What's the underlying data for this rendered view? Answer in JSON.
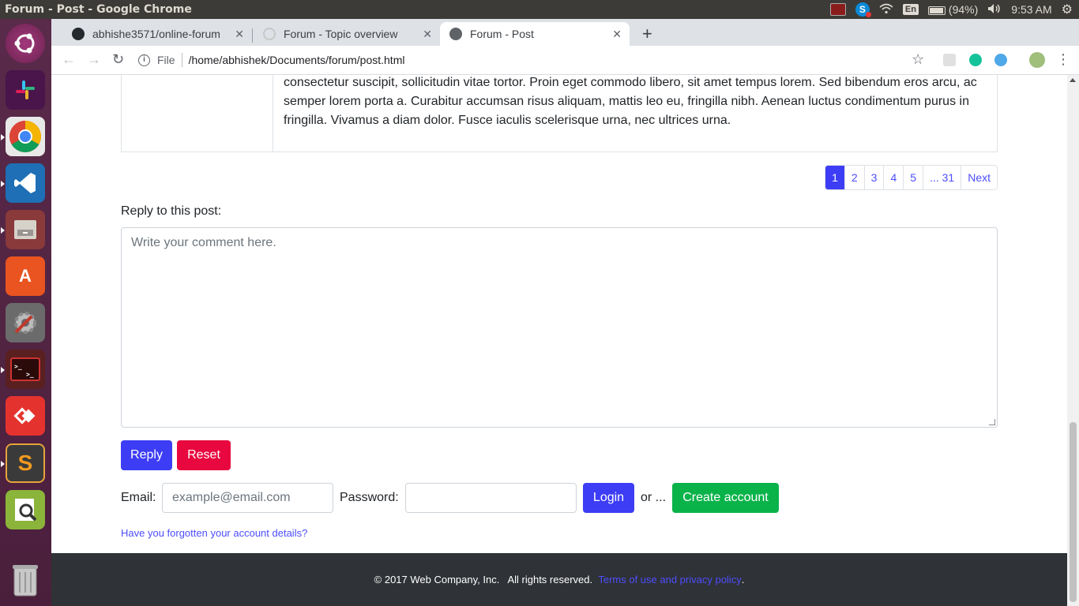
{
  "os": {
    "window_title": "Forum - Post - Google Chrome",
    "battery": "(94%)",
    "time": "9:53 AM",
    "keyboard_layout": "En"
  },
  "launcher": {
    "items": [
      "ubuntu-dash",
      "slack",
      "chrome",
      "vscode",
      "files",
      "software-center",
      "system-settings",
      "terminal",
      "anydesk",
      "sublime-text",
      "document-viewer",
      "trash"
    ]
  },
  "browser": {
    "tabs": [
      {
        "label": "abhishe3571/online-forum",
        "active": false
      },
      {
        "label": "Forum - Topic overview",
        "active": false
      },
      {
        "label": "Forum - Post",
        "active": true
      }
    ],
    "new_tab": "+",
    "address": {
      "scheme_label": "File",
      "url": "/home/abhishek/Documents/forum/post.html"
    }
  },
  "post": {
    "body": "consectetur suscipit, sollicitudin vitae tortor. Proin eget commodo libero, sit amet tempus lorem. Sed bibendum eros arcu, ac semper lorem porta a. Curabitur accumsan risus aliquam, mattis leo eu, fringilla nibh. Aenean luctus condimentum purus in fringilla. Vivamus a diam dolor. Fusce iaculis scelerisque urna, nec ultrices urna."
  },
  "pagination": {
    "pages": [
      "1",
      "2",
      "3",
      "4",
      "5",
      "... 31"
    ],
    "active": "1",
    "next": "Next"
  },
  "reply": {
    "label": "Reply to this post:",
    "placeholder": "Write your comment here.",
    "reply_button": "Reply",
    "reset_button": "Reset"
  },
  "login": {
    "email_label": "Email:",
    "email_placeholder": "example@email.com",
    "password_label": "Password:",
    "login_button": "Login",
    "or_text": "or ...",
    "create_button": "Create account",
    "forgot_link": "Have you forgotten your account details?"
  },
  "footer": {
    "copyright": "© 2017 Web Company, Inc.   All rights reserved.",
    "terms_link": "Terms of use and privacy policy",
    "period": "."
  },
  "colors": {
    "primary": "#3d3df5",
    "danger": "#e8073e",
    "success": "#0ab34a",
    "footer_bg": "#2f3236"
  }
}
